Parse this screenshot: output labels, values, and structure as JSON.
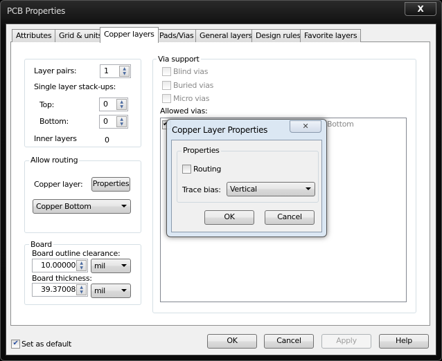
{
  "window": {
    "title": "PCB Properties",
    "close_label": "X"
  },
  "tabs": [
    {
      "label": "Attributes"
    },
    {
      "label": "Grid & units"
    },
    {
      "label": "Copper layers",
      "active": true
    },
    {
      "label": "Pads/Vias"
    },
    {
      "label": "General layers"
    },
    {
      "label": "Design rules"
    },
    {
      "label": "Favorite layers"
    }
  ],
  "layers": {
    "layer_pairs_label": "Layer pairs:",
    "layer_pairs": "1",
    "single_label": "Single layer stack-ups:",
    "top_label": "Top:",
    "top": "0",
    "bottom_label": "Bottom:",
    "bottom": "0",
    "inner_label": "Inner layers",
    "inner": "0"
  },
  "routing": {
    "group": "Allow routing",
    "copper_label": "Copper layer:",
    "properties_btn": "Properties",
    "copper_select": "Copper Bottom"
  },
  "board": {
    "group": "Board",
    "clearance_label": "Board outline clearance:",
    "clearance": "10.00000",
    "clearance_unit": "mil",
    "thickness_label": "Board thickness:",
    "thickness": "39.37008",
    "thickness_unit": "mil"
  },
  "vias": {
    "group": "Via support",
    "blind": "Blind vias",
    "buried": "Buried vias",
    "micro": "Micro vias",
    "allowed_label": "Allowed vias:",
    "allowed_items": [
      {
        "text": "Bottom",
        "checked": true
      }
    ]
  },
  "footer": {
    "set_default": "Set as default",
    "set_default_checked": true,
    "ok": "OK",
    "cancel": "Cancel",
    "apply": "Apply",
    "help": "Help"
  },
  "dialog": {
    "title": "Copper Layer Properties",
    "group": "Properties",
    "routing": "Routing",
    "routing_checked": false,
    "trace_bias_label": "Trace bias:",
    "trace_bias": "Vertical",
    "ok": "OK",
    "cancel": "Cancel"
  }
}
